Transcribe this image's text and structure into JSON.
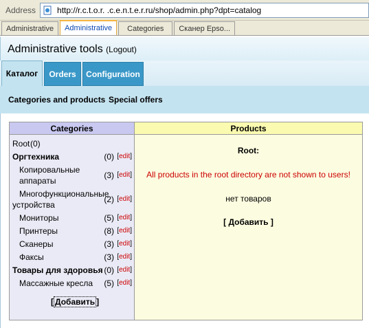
{
  "browser": {
    "address_label": "Address",
    "url": "http://r.c.t.o.r. .c.e.n.t.e.r.ru/shop/admin.php?dpt=catalog",
    "tabs": [
      "Administrative",
      "Administrative",
      "Categories",
      "Сканер Epso..."
    ],
    "active_tab_index": 1
  },
  "header": {
    "title": "Administrative tools",
    "logout": "(Logout)"
  },
  "section_tabs": [
    "Каталог",
    "Orders",
    "Configuration"
  ],
  "active_section": 0,
  "subnav": [
    "Categories and products",
    "Special offers"
  ],
  "categories": {
    "heading": "Categories",
    "items": [
      {
        "name": "Root",
        "count": "(0)",
        "level": 0,
        "bold": false,
        "editable": false
      },
      {
        "name": "Оргтехника",
        "count": "(0)",
        "level": 0,
        "bold": true,
        "editable": true
      },
      {
        "name": "Копировальные аппараты",
        "count": "(3)",
        "level": 1,
        "bold": false,
        "editable": true
      },
      {
        "name": "Многофункциональные устройства",
        "count": "(2)",
        "level": 1,
        "bold": false,
        "editable": true
      },
      {
        "name": "Мониторы",
        "count": "(5)",
        "level": 1,
        "bold": false,
        "editable": true
      },
      {
        "name": "Принтеры",
        "count": "(8)",
        "level": 1,
        "bold": false,
        "editable": true
      },
      {
        "name": "Сканеры",
        "count": "(3)",
        "level": 1,
        "bold": false,
        "editable": true
      },
      {
        "name": "Факсы",
        "count": "(3)",
        "level": 1,
        "bold": false,
        "editable": true
      },
      {
        "name": "Товары для здоровья",
        "count": "(0)",
        "level": 0,
        "bold": true,
        "editable": true
      },
      {
        "name": "Массажные кресла",
        "count": "(5)",
        "level": 1,
        "bold": false,
        "editable": true
      }
    ],
    "edit_label": "edit",
    "add_label": "Добавить"
  },
  "products": {
    "heading": "Products",
    "root_label": "Root:",
    "warning": "All products in the root directory are not shown to users!",
    "empty": "нет товаров",
    "add_label": "Добавить"
  }
}
